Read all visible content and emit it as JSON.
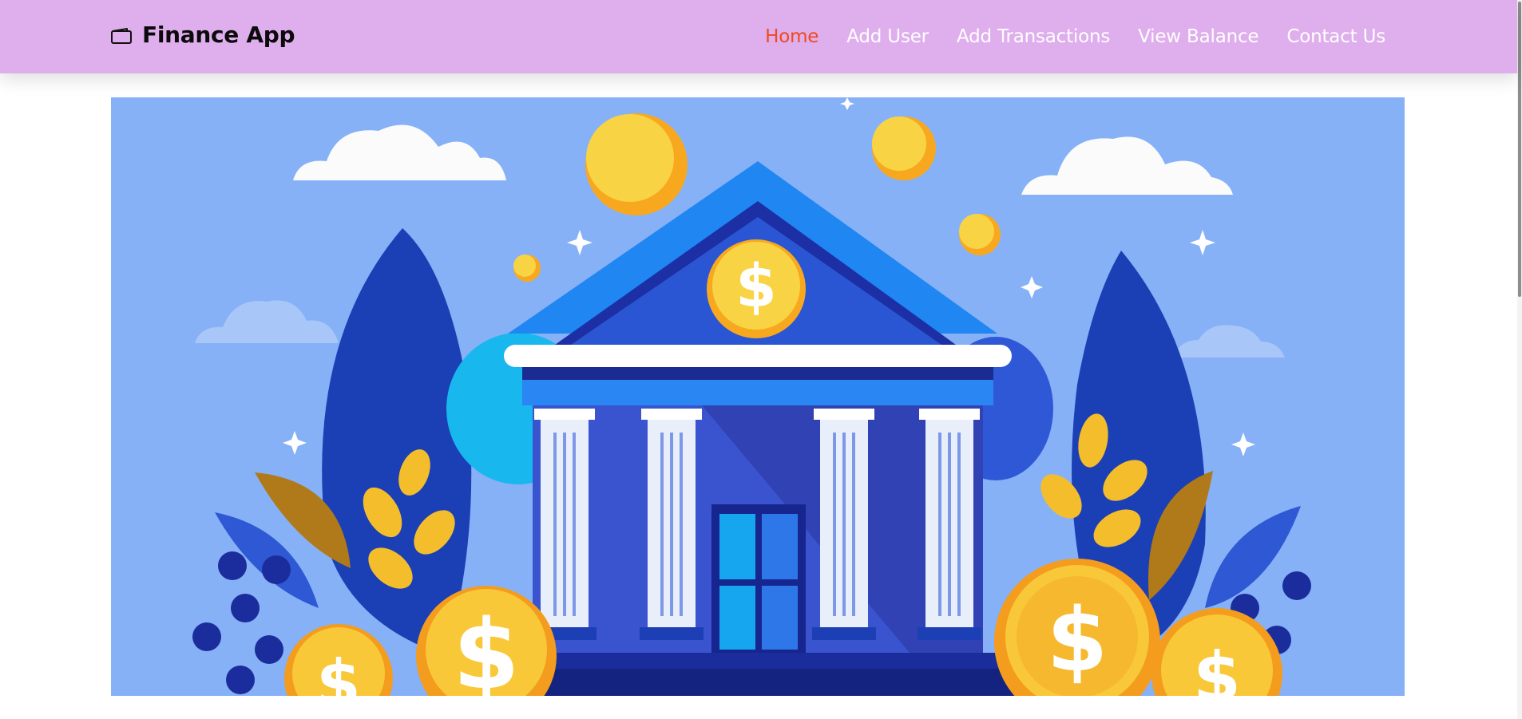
{
  "navbar": {
    "brand": {
      "label": "Finance App",
      "icon": "wallet-icon"
    },
    "links": [
      {
        "label": "Home",
        "active": true
      },
      {
        "label": "Add User",
        "active": false
      },
      {
        "label": "Add Transactions",
        "active": false
      },
      {
        "label": "View Balance",
        "active": false
      },
      {
        "label": "Contact Us",
        "active": false
      }
    ]
  },
  "hero": {
    "image_subject": "bank-illustration",
    "coin_symbol": "$"
  },
  "colors": {
    "navbar_background": "#dfaeed",
    "active_link": "#ee4a1f",
    "link": "#ffffff",
    "hero_background": "#86b1f7"
  }
}
